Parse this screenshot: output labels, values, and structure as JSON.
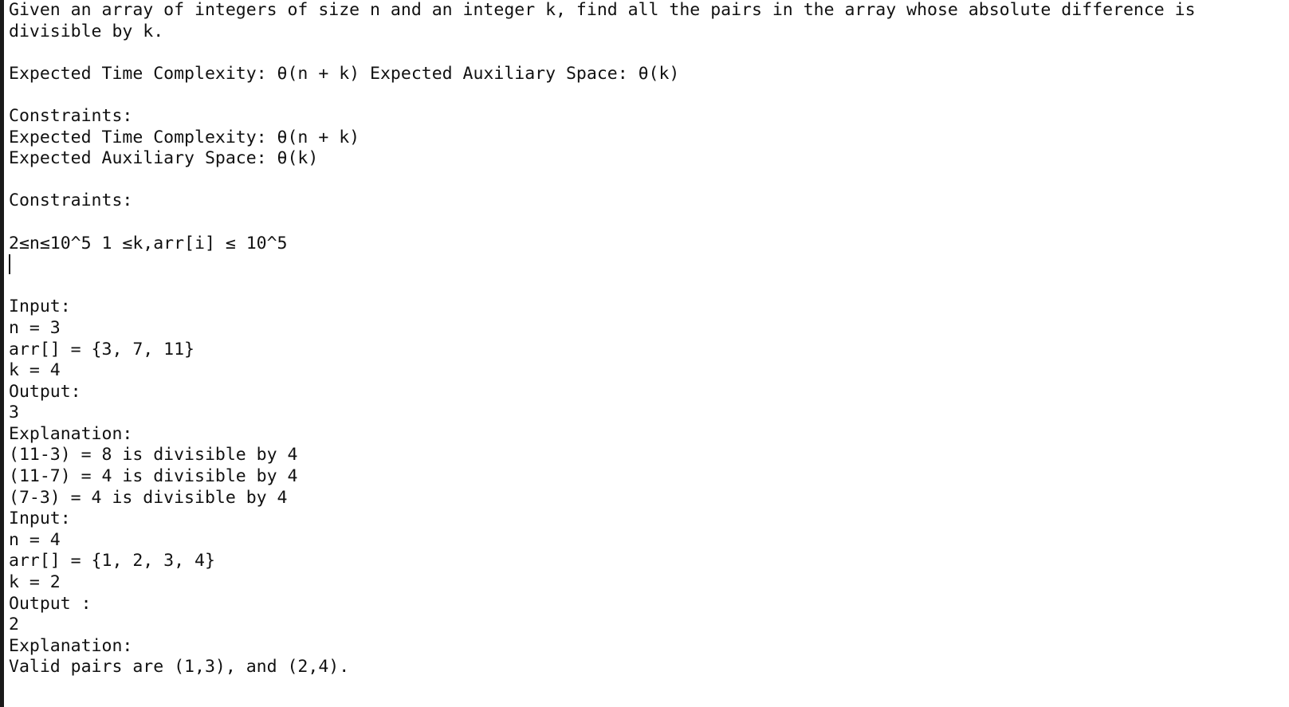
{
  "document": {
    "lines": [
      "Given an array of integers of size n and an integer k, find all the pairs in the array whose absolute difference is divisible by k.",
      "",
      "Expected Time Complexity: θ(n + k) Expected Auxiliary Space: θ(k)",
      "",
      "Constraints:",
      "Expected Time Complexity: θ(n + k)",
      "Expected Auxiliary Space: θ(k)",
      "",
      "Constraints:",
      "",
      "2≤n≤10^5 1 ≤k,arr[i] ≤ 10^5",
      "",
      "",
      "Input:",
      "n = 3",
      "arr[] = {3, 7, 11}",
      "k = 4",
      "Output:",
      "3",
      "Explanation:",
      "(11-3) = 8 is divisible by 4",
      "(11-7) = 4 is divisible by 4",
      "(7-3) = 4 is divisible by 4",
      "Input:",
      "n = 4",
      "arr[] = {1, 2, 3, 4}",
      "k = 2",
      "Output :",
      "2",
      "Explanation:",
      "Valid pairs are (1,3), and (2,4)."
    ]
  }
}
